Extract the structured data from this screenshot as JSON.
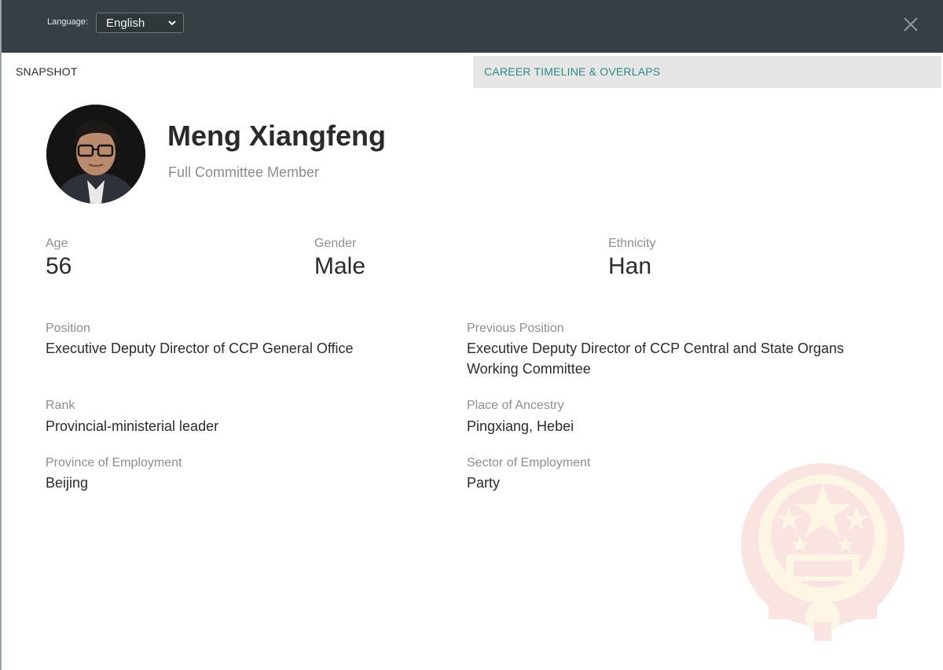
{
  "header": {
    "language_label": "Language:",
    "language_selected": "English"
  },
  "tabs": [
    {
      "label": "SNAPSHOT",
      "active": true
    },
    {
      "label": "CAREER TIMELINE & OVERLAPS",
      "active": false
    }
  ],
  "profile": {
    "name": "Meng Xiangfeng",
    "title": "Full Committee Member"
  },
  "stats": {
    "age": {
      "label": "Age",
      "value": "56"
    },
    "gender": {
      "label": "Gender",
      "value": "Male"
    },
    "ethnicity": {
      "label": "Ethnicity",
      "value": "Han"
    }
  },
  "details": {
    "position": {
      "label": "Position",
      "value": "Executive Deputy Director of CCP General Office"
    },
    "previous_position": {
      "label": "Previous Position",
      "value": "Executive Deputy Director of CCP Central and State Organs Working Committee"
    },
    "rank": {
      "label": "Rank",
      "value": "Provincial-ministerial leader"
    },
    "ancestry": {
      "label": "Place of Ancestry",
      "value": "Pingxiang, Hebei"
    },
    "province": {
      "label": "Province of Employment",
      "value": "Beijing"
    },
    "sector": {
      "label": "Sector of Employment",
      "value": "Party"
    }
  },
  "colors": {
    "header_bg": "#363f43",
    "accent_teal": "#2b8c84",
    "inactive_tab_bg": "#e6e6e6",
    "muted_label": "#8e8e8e"
  },
  "icons": {
    "close": "close-icon",
    "dropdown": "chevron-down-icon",
    "avatar": "profile-photo",
    "watermark": "national-emblem-watermark"
  }
}
